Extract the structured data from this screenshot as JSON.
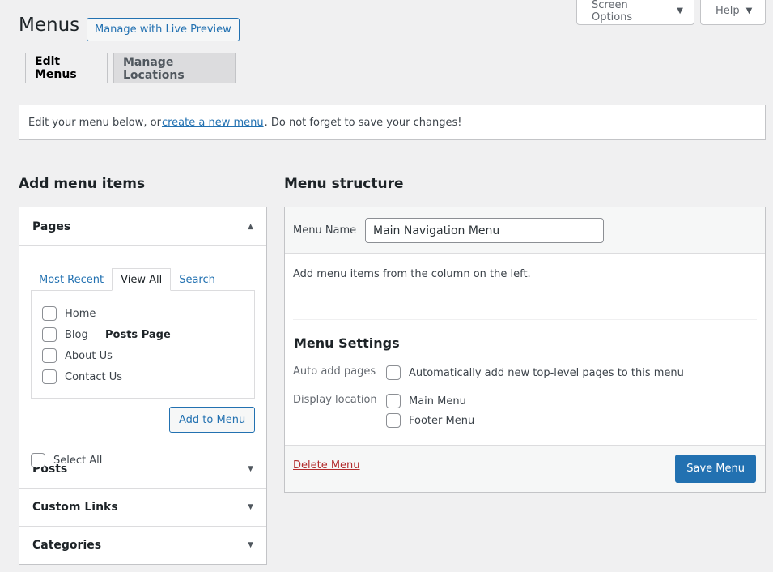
{
  "header": {
    "title": "Menus",
    "live_preview_label": "Manage with Live Preview",
    "screen_options_label": "Screen Options",
    "help_label": "Help"
  },
  "tabs": [
    {
      "label": "Edit Menus",
      "active": true
    },
    {
      "label": "Manage Locations",
      "active": false
    }
  ],
  "notice": {
    "prefix": "Edit your menu below, or ",
    "link": "create a new menu",
    "suffix": ". Do not forget to save your changes!"
  },
  "add_items": {
    "heading": "Add menu items",
    "pages": {
      "title": "Pages",
      "tabs": [
        "Most Recent",
        "View All",
        "Search"
      ],
      "active_tab": "View All",
      "items": [
        {
          "label": "Home",
          "checked": false
        },
        {
          "label": "Blog",
          "sep": " — ",
          "suffix": "Posts Page",
          "checked": false
        },
        {
          "label": "About Us",
          "checked": false
        },
        {
          "label": "Contact Us",
          "checked": false
        }
      ],
      "select_all_label": "Select All",
      "add_button_label": "Add to Menu"
    },
    "sections": [
      {
        "title": "Posts"
      },
      {
        "title": "Custom Links"
      },
      {
        "title": "Categories"
      }
    ]
  },
  "structure": {
    "heading": "Menu structure",
    "menu_name_label": "Menu Name",
    "menu_name_value": "Main Navigation Menu",
    "empty_hint": "Add menu items from the column on the left.",
    "settings_heading": "Menu Settings",
    "auto_add_label": "Auto add pages",
    "auto_add_option": "Automatically add new top-level pages to this menu",
    "display_location_label": "Display location",
    "locations": [
      "Main Menu",
      "Footer Menu"
    ],
    "delete_label": "Delete Menu",
    "save_label": "Save Menu"
  },
  "colors": {
    "accent": "#2271b1",
    "delete": "#b32d2e",
    "background": "#f0f0f1"
  }
}
